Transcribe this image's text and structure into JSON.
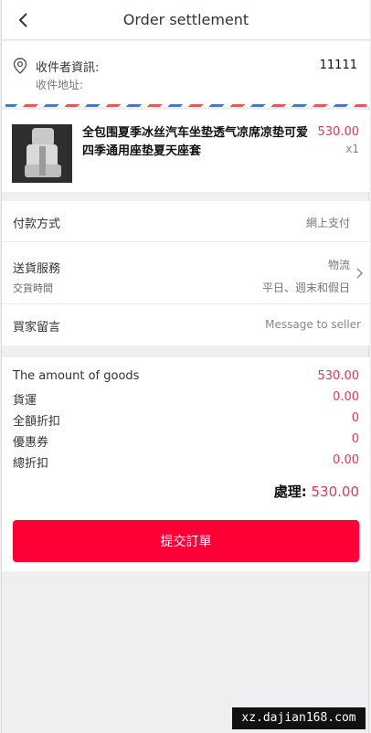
{
  "header": {
    "title": "Order settlement",
    "back_icon": "chevron-left-icon"
  },
  "address": {
    "icon": "location-pin-icon",
    "name_label": "收件者資訊:",
    "phone": "11111",
    "address_label": "收件地址:"
  },
  "goods": {
    "name": "全包围夏季冰丝汽车坐垫透气凉席凉垫可爱四季通用座垫夏天座套",
    "price": "530.00",
    "quantity": "x1"
  },
  "options": {
    "payment": {
      "label": "付款方式",
      "value": "網上支付"
    },
    "delivery": {
      "label": "送貨服務",
      "value": "物流",
      "time_label": "交貨時間",
      "time_value": "平日、週末和假日"
    },
    "message": {
      "label": "買家留言",
      "placeholder": "Message to seller"
    }
  },
  "summary": {
    "rows": [
      {
        "label": "The amount of goods",
        "value": "530.00"
      },
      {
        "label": "貨運",
        "value": "0.00"
      },
      {
        "label": "全額折扣",
        "value": "0"
      },
      {
        "label": "優惠券",
        "value": "0"
      },
      {
        "label": "總折扣",
        "value": "0.00"
      }
    ],
    "total_label": "處理:",
    "total_value": "530.00"
  },
  "submit_label": "提交訂單",
  "watermark": "xz.dajian168.com",
  "colors": {
    "accent": "#ff0036",
    "price": "#e8365d"
  }
}
